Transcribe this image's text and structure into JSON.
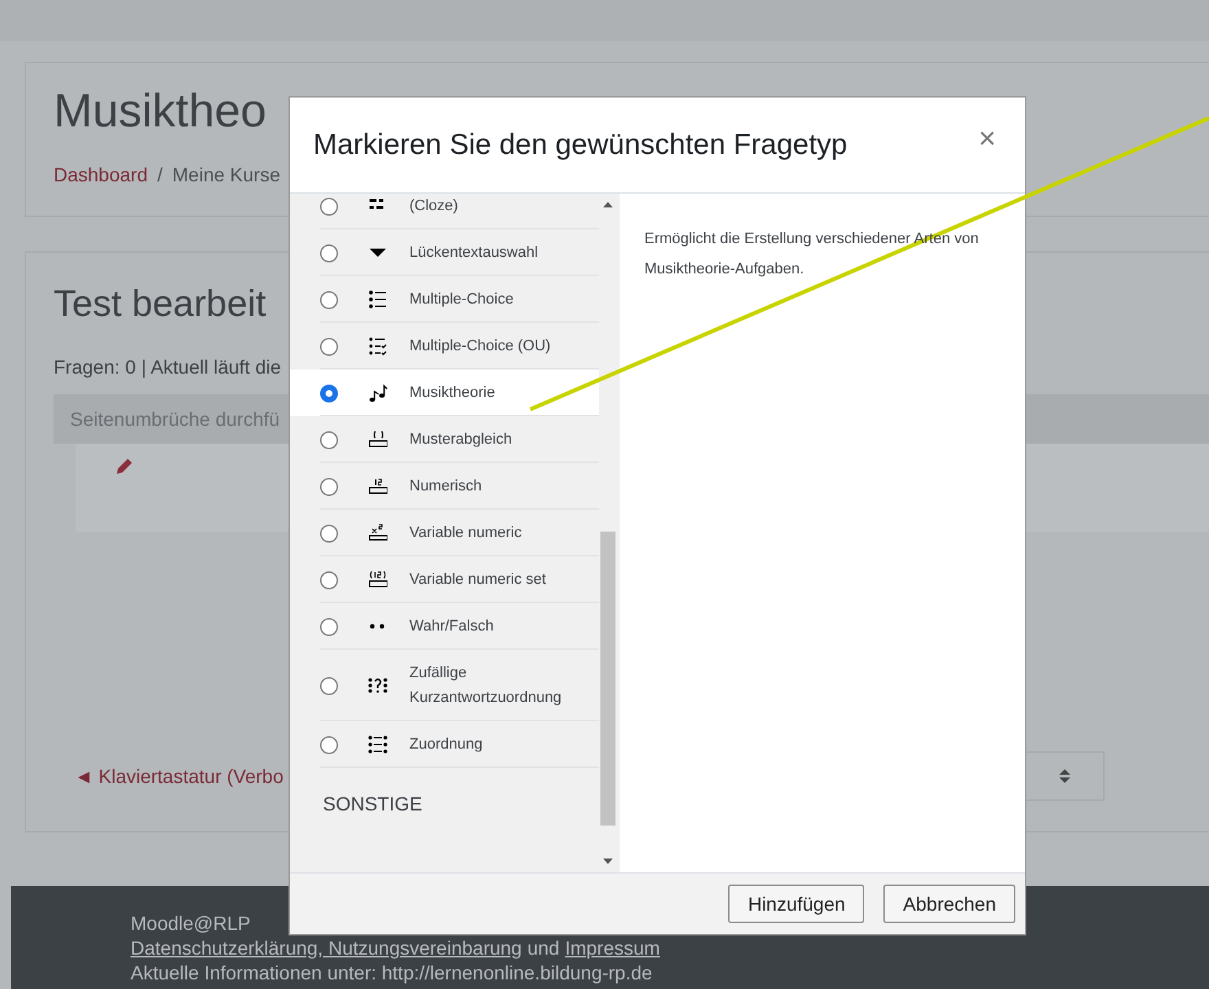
{
  "page": {
    "title": "Musiktheo",
    "breadcrumb": [
      {
        "label": "Dashboard",
        "kind": "link"
      },
      {
        "label": "/",
        "kind": "separator"
      },
      {
        "label": "Meine Kurse",
        "kind": "text"
      }
    ],
    "section_title": "Test bearbeit",
    "info": "Fragen: 0 | Aktuell läuft die",
    "page_break_bar": "Seitenumbrüche durchfü",
    "nav_link": "◄ Klaviertastatur (Verbo"
  },
  "modal": {
    "title": "Markieren Sie den gewünschten Fragetyp",
    "close": "×",
    "items": [
      {
        "label": "(Cloze)",
        "selected": false
      },
      {
        "label": "Lückentextauswahl",
        "selected": false
      },
      {
        "label": "Multiple-Choice",
        "selected": false
      },
      {
        "label": "Multiple-Choice (OU)",
        "selected": false
      },
      {
        "label": "Musiktheorie",
        "selected": true
      },
      {
        "label": "Musterabgleich",
        "selected": false
      },
      {
        "label": "Numerisch",
        "selected": false
      },
      {
        "label": "Variable numeric",
        "selected": false
      },
      {
        "label": "Variable numeric set",
        "selected": false
      },
      {
        "label": "Wahr/Falsch",
        "selected": false
      },
      {
        "label": "Zufällige Kurzantwortzuordnung",
        "selected": false
      },
      {
        "label": "Zuordnung",
        "selected": false
      }
    ],
    "category": "SONSTIGE",
    "description": "Ermöglicht die Erstellung verschiedener Arten von Musiktheorie-Aufgaben.",
    "buttons": [
      "Hinzufügen",
      "Abbrechen"
    ]
  },
  "footer": {
    "site": "Moodle@RLP",
    "links": [
      {
        "text": "Datenschutzerklärung, Nutzungsvereinbarung",
        "kind": "link"
      },
      {
        "text": "und",
        "kind": "text"
      },
      {
        "text": "Impressum",
        "kind": "link"
      }
    ],
    "info": "Aktuelle Informationen unter: http://lernenonline.bildung-rp.de"
  }
}
